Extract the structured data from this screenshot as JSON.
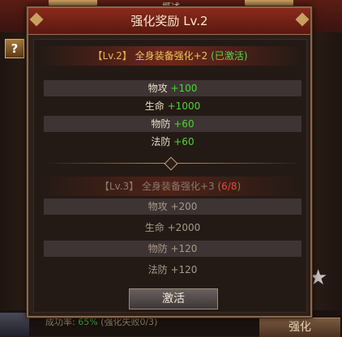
{
  "background": {
    "title_stub": "概述",
    "help_label": "?",
    "strip_label": "成功率:",
    "strip_value": "65%",
    "strip_note": "(强化失败0/3)",
    "strength_button": "强化",
    "star_icon": "star-icon",
    "help_icon": "question-icon"
  },
  "modal": {
    "title": "强化奖励 Lv.2",
    "current": {
      "level_tag": "【Lv.2】",
      "title": "全身装备强化+2",
      "status": "(已激活)",
      "stats": [
        {
          "name": "物攻",
          "value": "+100"
        },
        {
          "name": "生命",
          "value": "+1000"
        },
        {
          "name": "物防",
          "value": "+60"
        },
        {
          "name": "法防",
          "value": "+60"
        }
      ]
    },
    "next": {
      "level_tag": "【Lv.3】",
      "title": "全身装备强化+3",
      "progress_open": "(",
      "progress_current": "6",
      "progress_sep": "/",
      "progress_total": "8",
      "progress_close": ")",
      "stats": [
        {
          "name": "物攻",
          "value": "+200"
        },
        {
          "name": "生命",
          "value": "+2000"
        },
        {
          "name": "物防",
          "value": "+120"
        },
        {
          "name": "法防",
          "value": "+120"
        }
      ]
    },
    "activate_button": "激活"
  },
  "colors": {
    "active_title": "#e8c858",
    "active_status": "#58d848",
    "active_value": "#48d830",
    "progress": "#e84838",
    "inactive_text": "#a89888"
  }
}
